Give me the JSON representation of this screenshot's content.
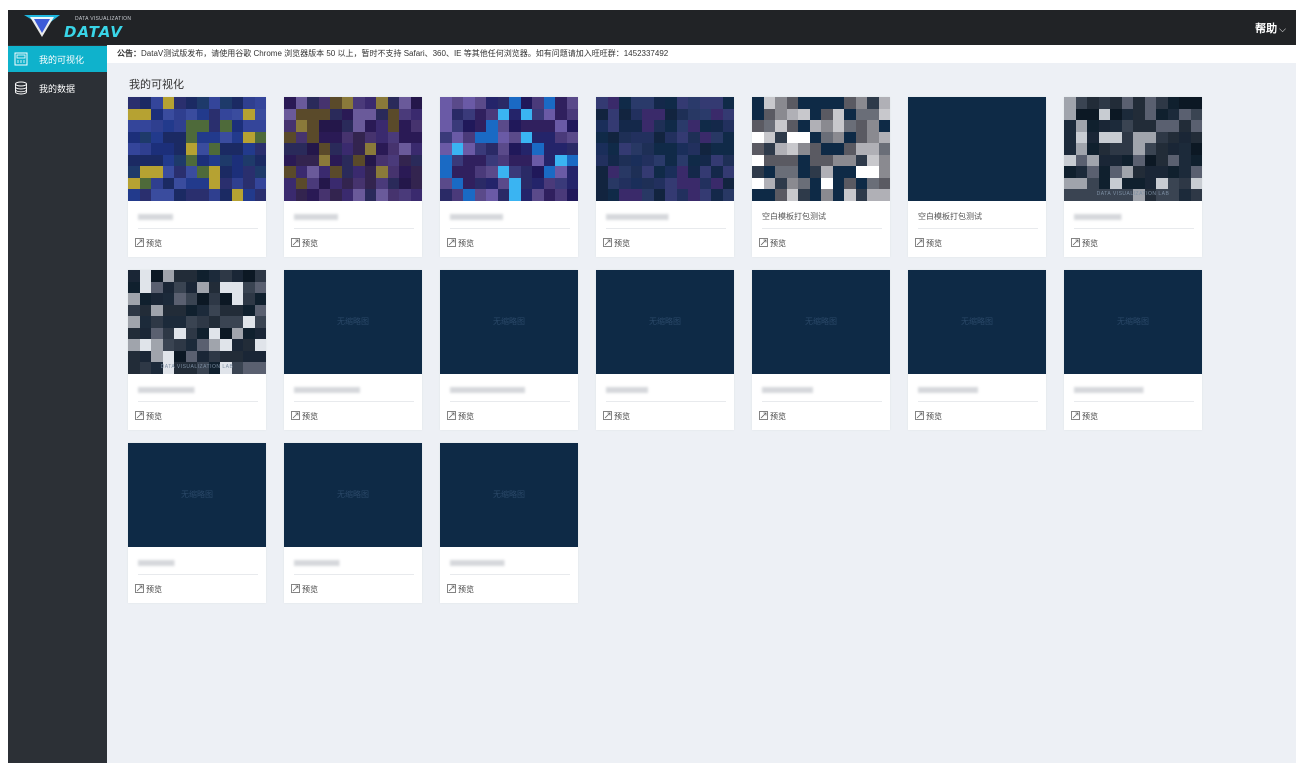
{
  "header": {
    "logo_sub": "DATA VISUALIZATION",
    "logo_main": "DATAV",
    "help_label": "帮助"
  },
  "sidebar": {
    "items": [
      {
        "label": "我的可视化",
        "icon": "visualization-icon",
        "active": true
      },
      {
        "label": "我的数据",
        "icon": "database-icon",
        "active": false
      }
    ]
  },
  "notice": {
    "label": "公告：",
    "text": "DataV测试版发布，请使用谷歌 Chrome 浏览器版本 50 以上，暂时不支持 Safari、360、IE 等其他任何浏览器。如有问题请加入旺旺群：1452337492"
  },
  "main": {
    "title": "我的可视化",
    "preview_label": "预览",
    "no_thumb_label": "无缩略图",
    "cards": [
      {
        "name": "",
        "thumb": "mosaic",
        "theme": "blue"
      },
      {
        "name": "",
        "thumb": "mosaic",
        "theme": "purple"
      },
      {
        "name": "",
        "thumb": "mosaic",
        "theme": "bright"
      },
      {
        "name": "",
        "thumb": "mosaic",
        "theme": "dark"
      },
      {
        "name": "空白模板打包测试",
        "thumb": "mosaic",
        "theme": "grey"
      },
      {
        "name": "空白模板打包测试",
        "thumb": "empty",
        "theme": "none"
      },
      {
        "name": "",
        "thumb": "mosaic",
        "theme": "lab"
      },
      {
        "name": "",
        "thumb": "mosaic",
        "theme": "lab2"
      },
      {
        "name": "",
        "thumb": "none",
        "theme": "none"
      },
      {
        "name": "",
        "thumb": "none",
        "theme": "none"
      },
      {
        "name": "",
        "thumb": "none",
        "theme": "none"
      },
      {
        "name": "",
        "thumb": "none",
        "theme": "none"
      },
      {
        "name": "",
        "thumb": "none",
        "theme": "none"
      },
      {
        "name": "",
        "thumb": "none",
        "theme": "none"
      },
      {
        "name": "",
        "thumb": "none",
        "theme": "none"
      },
      {
        "name": "",
        "thumb": "none",
        "theme": "none"
      },
      {
        "name": "",
        "thumb": "none",
        "theme": "none"
      }
    ],
    "lab_caption": "DATA VISUALIZATION LAB"
  },
  "colors": {
    "accent": "#0fb2cc",
    "header_bg": "#212326",
    "sidebar_bg": "#2c3036",
    "thumb_bg": "#0e2a46",
    "page_bg": "#edf0f5"
  }
}
